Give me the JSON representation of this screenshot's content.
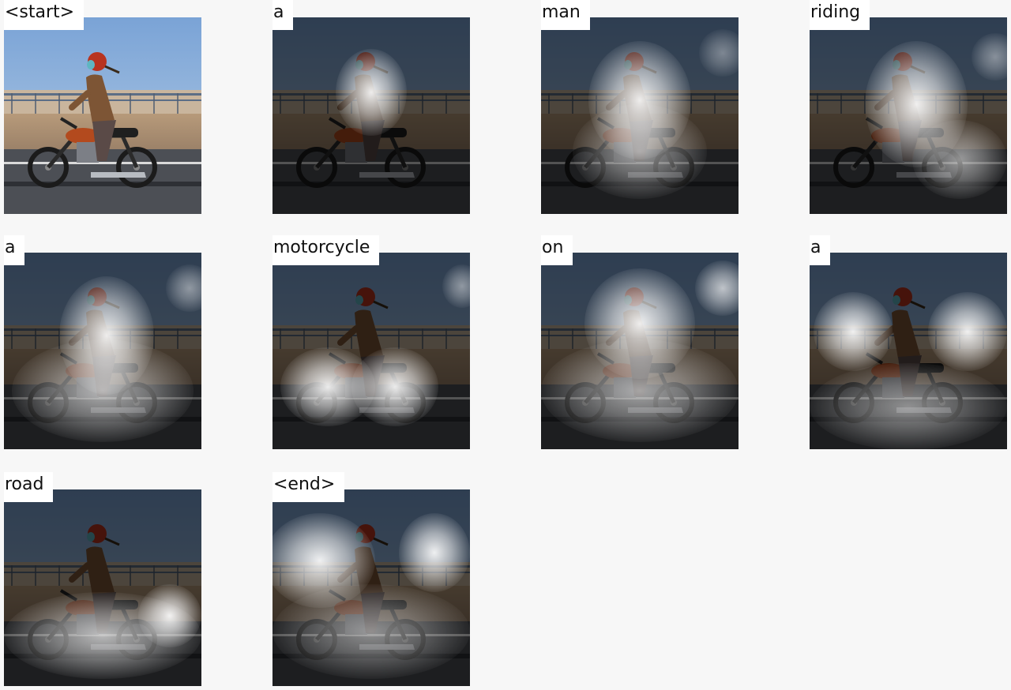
{
  "panels": [
    {
      "token": "<start>",
      "attention": []
    },
    {
      "token": "a",
      "attention": [
        "rider-upper-body"
      ]
    },
    {
      "token": "man",
      "attention": [
        "rider-full",
        "sky-top-right"
      ]
    },
    {
      "token": "riding",
      "attention": [
        "rider-full",
        "bike-rear",
        "sky-top-right"
      ]
    },
    {
      "token": "a",
      "attention": [
        "rider-full",
        "bike-full",
        "sky-right"
      ]
    },
    {
      "token": "motorcycle",
      "attention": [
        "bike-wheels",
        "sky-right"
      ]
    },
    {
      "token": "on",
      "attention": [
        "rider-head",
        "bike-full",
        "sky-right-bright"
      ]
    },
    {
      "token": "a",
      "attention": [
        "fence-left",
        "fence-right",
        "road-band"
      ]
    },
    {
      "token": "road",
      "attention": [
        "road-band",
        "fence-left-dim"
      ]
    },
    {
      "token": "<end>",
      "attention": [
        "sky-left",
        "sky-right-bright",
        "road-band"
      ]
    }
  ]
}
